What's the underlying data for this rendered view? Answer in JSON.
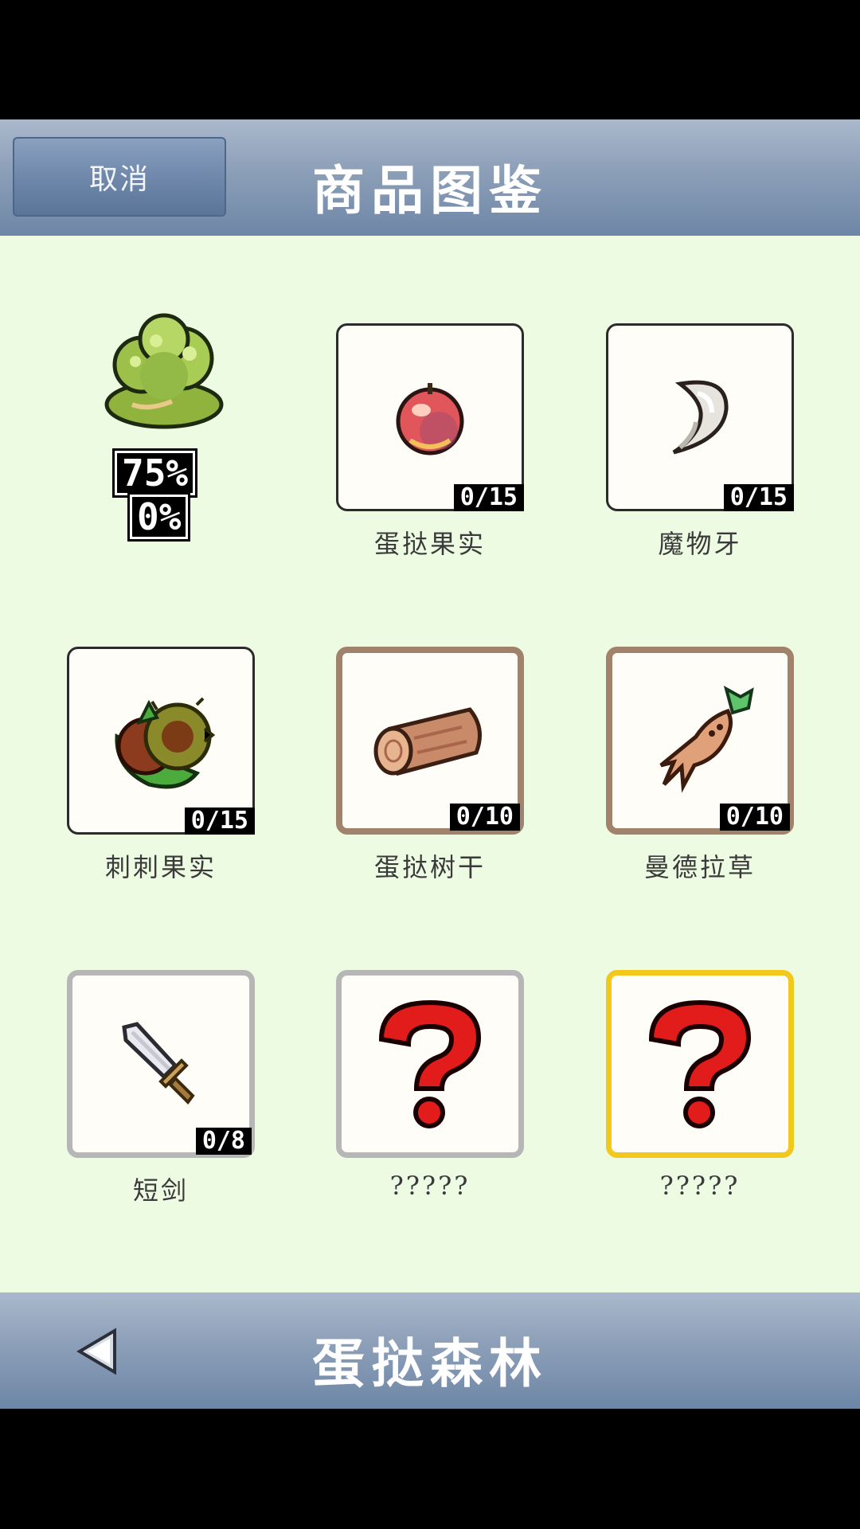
{
  "header": {
    "cancel_label": "取消",
    "title": "商品图鉴"
  },
  "area": {
    "name": "蛋挞森林",
    "percent_a": "75%",
    "percent_b": "0%"
  },
  "items": [
    {
      "name": "蛋挞果实",
      "count": "0/15",
      "icon": "apple-icon"
    },
    {
      "name": "魔物牙",
      "count": "0/15",
      "icon": "fang-icon"
    },
    {
      "name": "刺刺果实",
      "count": "0/15",
      "icon": "spiky-fruit-icon"
    },
    {
      "name": "蛋挞树干",
      "count": "0/10",
      "icon": "log-icon"
    },
    {
      "name": "曼德拉草",
      "count": "0/10",
      "icon": "mandrake-icon"
    },
    {
      "name": "短剑",
      "count": "0/8",
      "icon": "dagger-icon"
    },
    {
      "name": "?????",
      "count": "",
      "icon": "question-mark-icon"
    },
    {
      "name": "?????",
      "count": "",
      "icon": "question-mark-icon"
    }
  ],
  "colors": {
    "bar": "#8c9fb8",
    "background": "#eefbe3",
    "brown_frame": "#a1836c",
    "gold_frame": "#f2c81d"
  }
}
